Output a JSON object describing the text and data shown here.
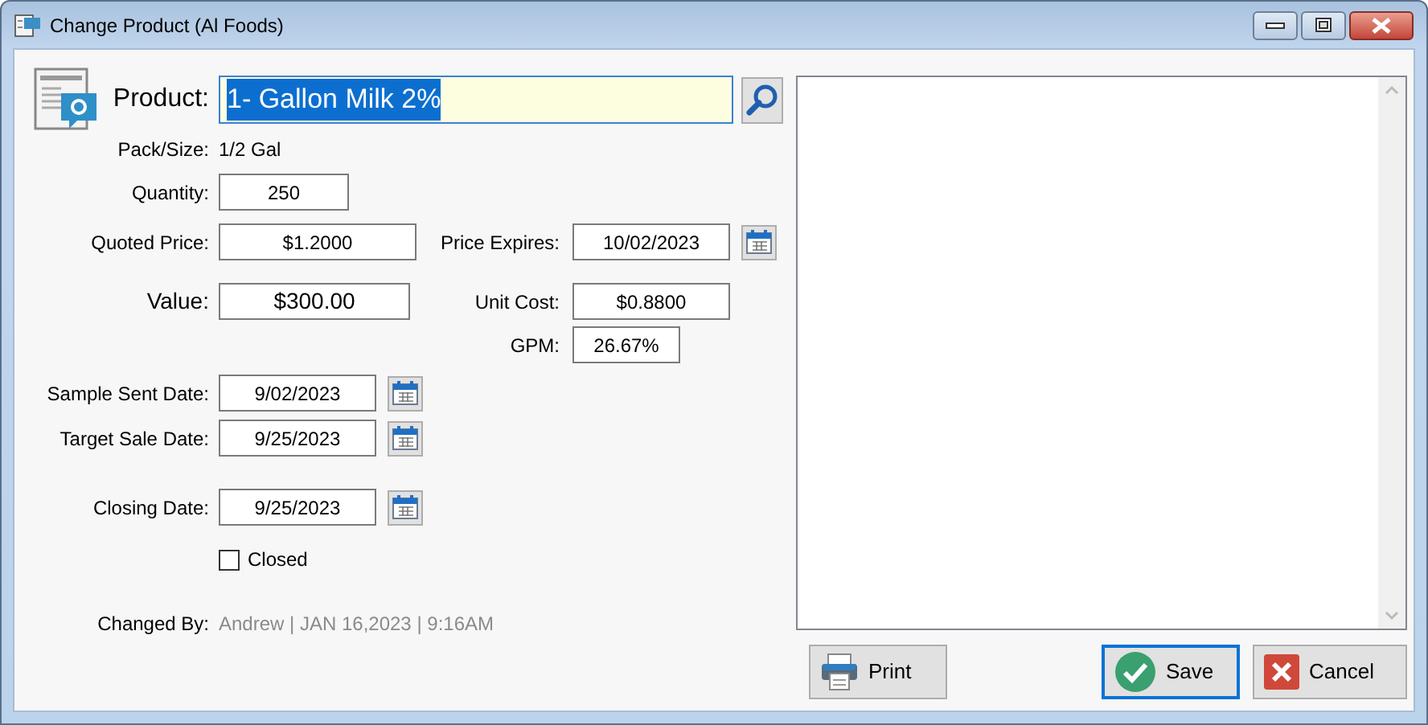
{
  "window": {
    "title": "Change Product  (Al Foods)"
  },
  "product": {
    "label": "Product:",
    "value": "1- Gallon Milk 2%",
    "text_selected": true
  },
  "pack_size": {
    "label": "Pack/Size:",
    "value": "1/2 Gal"
  },
  "quantity": {
    "label": "Quantity:",
    "value": "250"
  },
  "quoted_price": {
    "label": "Quoted Price:",
    "value": "$1.2000"
  },
  "price_expires": {
    "label": "Price Expires:",
    "value": "10/02/2023"
  },
  "value": {
    "label": "Value:",
    "value": "$300.00"
  },
  "unit_cost": {
    "label": "Unit Cost:",
    "value": "$0.8800"
  },
  "gpm": {
    "label": "GPM:",
    "value": "26.67%"
  },
  "sample_sent_date": {
    "label": "Sample Sent Date:",
    "value": "9/02/2023"
  },
  "target_sale_date": {
    "label": "Target Sale Date:",
    "value": "9/25/2023"
  },
  "closing_date": {
    "label": "Closing Date:",
    "value": "9/25/2023"
  },
  "closed": {
    "label": "Closed",
    "checked": false
  },
  "changed_by": {
    "label": "Changed By:",
    "value": "Andrew | JAN 16,2023 |  9:16AM"
  },
  "buttons": [
    {
      "label": "Print",
      "kind": "print",
      "focused": false
    },
    {
      "label": "Save",
      "kind": "save",
      "focused": true
    },
    {
      "label": "Cancel",
      "kind": "cancel",
      "focused": false
    }
  ]
}
